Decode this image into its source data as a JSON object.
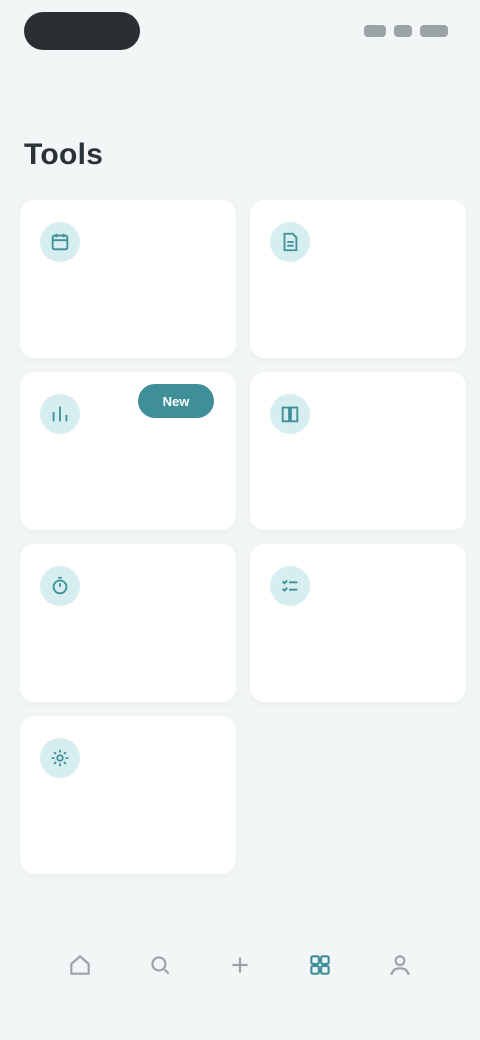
{
  "status_bar": {
    "time": "",
    "icons": [
      "signal-icon",
      "wifi-icon",
      "battery-icon"
    ]
  },
  "page": {
    "title": "Tools"
  },
  "cards": [
    {
      "label": "",
      "icon": "calendar-icon",
      "badge": ""
    },
    {
      "label": "",
      "icon": "document-icon"
    },
    {
      "label": "",
      "icon": "chart-icon",
      "badge": "New"
    },
    {
      "label": "",
      "icon": "book-icon"
    },
    {
      "label": "",
      "icon": "timer-icon"
    },
    {
      "label": "",
      "icon": "checklist-icon"
    },
    {
      "label": "",
      "icon": "settings-icon"
    }
  ],
  "bottom_nav": {
    "active_index": 3,
    "items": [
      {
        "label": "",
        "icon": "home-icon"
      },
      {
        "label": "",
        "icon": "search-icon"
      },
      {
        "label": "",
        "icon": "plus-icon"
      },
      {
        "label": "",
        "icon": "tools-icon"
      },
      {
        "label": "",
        "icon": "profile-icon"
      }
    ]
  },
  "colors": {
    "accent": "#3e8f98",
    "background": "#f2f6f7",
    "card": "#ffffff",
    "icon_bg": "#d7eef0"
  }
}
